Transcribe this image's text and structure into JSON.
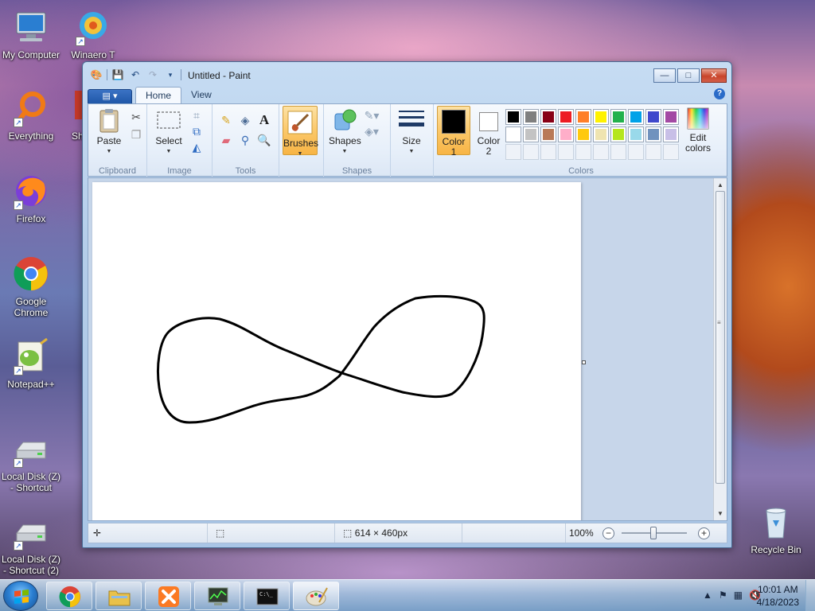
{
  "desktop": {
    "icons": [
      {
        "label": "My Computer"
      },
      {
        "label": "Winaero T"
      },
      {
        "label": "Everything"
      },
      {
        "label": "Sh"
      },
      {
        "label": "Firefox"
      },
      {
        "label": "Google Chrome"
      },
      {
        "label": "Notepad++"
      },
      {
        "label": "Local Disk (Z) - Shortcut"
      },
      {
        "label": "Local Disk (Z) - Shortcut (2)"
      },
      {
        "label": "Recycle Bin"
      }
    ]
  },
  "window": {
    "title": "Untitled - Paint",
    "buttons": {
      "minimize": "—",
      "maximize": "□",
      "close": "✕"
    }
  },
  "ribbon": {
    "file_tab": "▤ ▾",
    "tabs": [
      {
        "label": "Home"
      },
      {
        "label": "View"
      }
    ],
    "groups": {
      "clipboard": {
        "label": "Clipboard",
        "paste": "Paste"
      },
      "image": {
        "label": "Image",
        "select": "Select"
      },
      "tools": {
        "label": "Tools"
      },
      "brushes": {
        "label": "Brushes"
      },
      "shapes": {
        "label": "Shapes",
        "shapes_btn": "Shapes"
      },
      "size": {
        "label": "Size"
      },
      "colors": {
        "label": "Colors",
        "color1": "Color 1",
        "color2": "Color 2",
        "edit_colors": "Edit colors",
        "color1_value": "#000000",
        "color2_value": "#ffffff",
        "palette_row1": [
          "#000000",
          "#7f7f7f",
          "#880015",
          "#ed1c24",
          "#ff7f27",
          "#fff200",
          "#22b14c",
          "#00a2e8",
          "#3f48cc",
          "#a349a4"
        ],
        "palette_row2": [
          "#ffffff",
          "#c3c3c3",
          "#b97a57",
          "#ffaec9",
          "#ffc90e",
          "#efe4b0",
          "#b5e61d",
          "#99d9ea",
          "#7092be",
          "#c8bfe7"
        ]
      }
    }
  },
  "canvas": {
    "stroke_color": "#000000"
  },
  "statusbar": {
    "dimensions": "614 × 460px",
    "zoom": "100%"
  },
  "taskbar": {
    "time": "10:01 AM",
    "date": "4/18/2023"
  }
}
